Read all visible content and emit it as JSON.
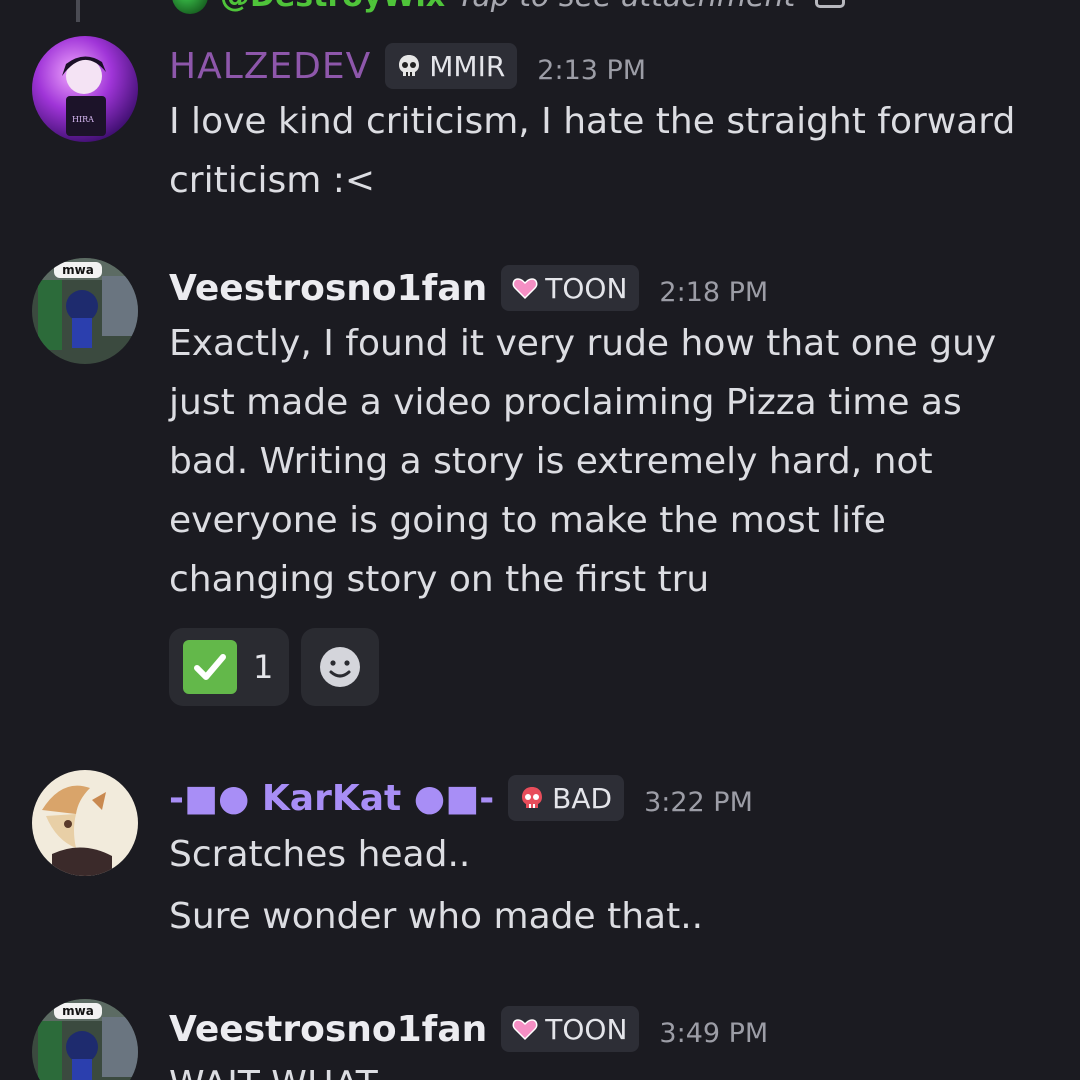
{
  "reply_preview": {
    "author": "@DestroyWix",
    "text": "Tap to see attachment"
  },
  "messages": [
    {
      "author": "HALZEDEV",
      "tag": "MMIR",
      "tag_icon": "skull-icon",
      "time": "2:13 PM",
      "lines": [
        "I love kind criticism, I hate the straight forward criticism :<"
      ]
    },
    {
      "author": "Veestrosno1fan",
      "tag": "TOON",
      "tag_icon": "pink-heart-icon",
      "time": "2:18 PM",
      "lines": [
        "Exactly, I found it very rude how that one guy just made a video proclaiming Pizza time as bad. Writing a story is extremely hard, not everyone is going to make the most life changing story on the first tru"
      ],
      "reactions": [
        {
          "emoji": "check-mark-icon",
          "count": "1"
        },
        {
          "emoji": "add-reaction-icon"
        }
      ]
    },
    {
      "author": "-■● KarKat ●■-",
      "tag": "BAD",
      "tag_icon": "red-skull-icon",
      "time": "3:22 PM",
      "lines": [
        "Scratches head..",
        "Sure wonder who made that.."
      ]
    },
    {
      "author": "Veestrosno1fan",
      "tag": "TOON",
      "tag_icon": "pink-heart-icon",
      "time": "3:49 PM",
      "lines": [
        "WAIT WHAT"
      ]
    }
  ],
  "avatar_badge_text": "mwa",
  "colors": {
    "background": "#1b1b21",
    "halzedev_name": "#8e57ab",
    "karkat_name": "#a88ef6",
    "reply_author": "#4fc43a",
    "tag_bg": "#2d2e36",
    "reaction_check": "#63b84a"
  }
}
